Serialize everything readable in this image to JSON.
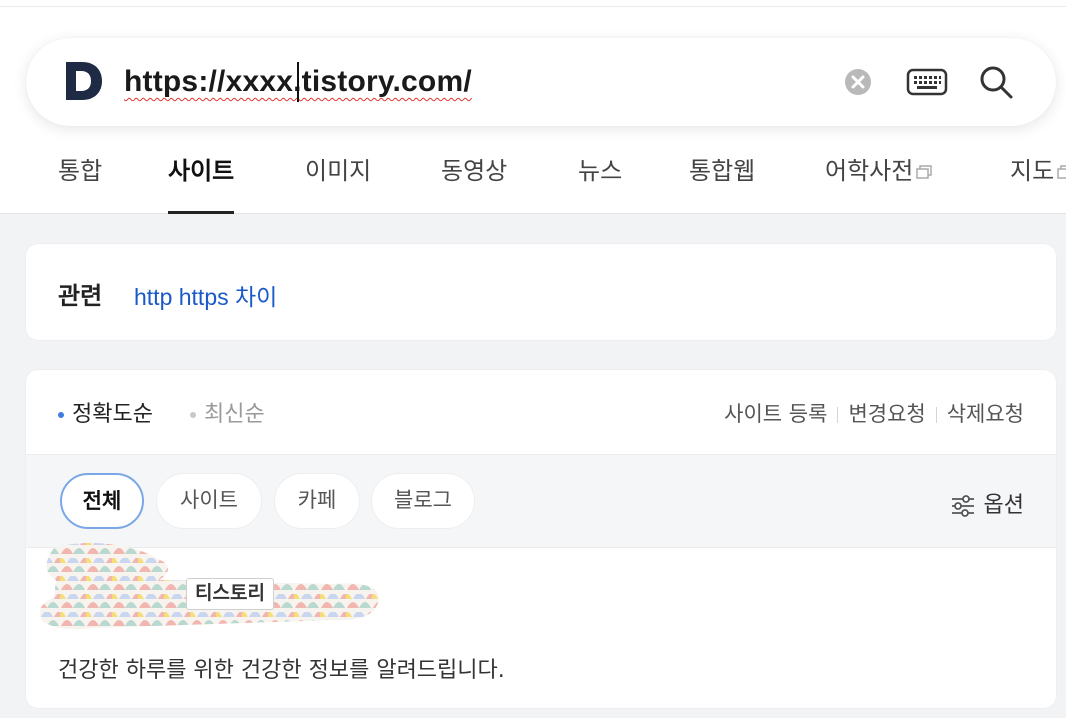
{
  "search": {
    "url_value": "https://xxxx.tistory.com/",
    "icons": [
      "d-logo-icon",
      "clear-icon",
      "keyboard-icon",
      "search-icon"
    ]
  },
  "tabs": [
    {
      "label": "통합",
      "active": false
    },
    {
      "label": "사이트",
      "active": true
    },
    {
      "label": "이미지",
      "active": false
    },
    {
      "label": "동영상",
      "active": false
    },
    {
      "label": "뉴스",
      "active": false
    },
    {
      "label": "통합웹",
      "active": false
    },
    {
      "label": "어학사전",
      "active": false,
      "external": true
    },
    {
      "label": "지도",
      "active": false,
      "external": true
    }
  ],
  "related": {
    "label": "관련",
    "link": "http https 차이"
  },
  "sort": {
    "accuracy": "정확도순",
    "latest": "최신순"
  },
  "site_actions": {
    "register": "사이트 등록",
    "change": "변경요청",
    "delete": "삭제요청"
  },
  "filters": {
    "all": "전체",
    "site": "사이트",
    "cafe": "카페",
    "blog": "블로그",
    "options": "옵션"
  },
  "result": {
    "source_badge": "티스토리",
    "description": "건강한 하루를 위한 건강한 정보를 알려드립니다."
  },
  "colors": {
    "accent_blue": "#1a59c8",
    "active_chip_border": "#7aa7e8",
    "logo": "#1f2a44"
  }
}
